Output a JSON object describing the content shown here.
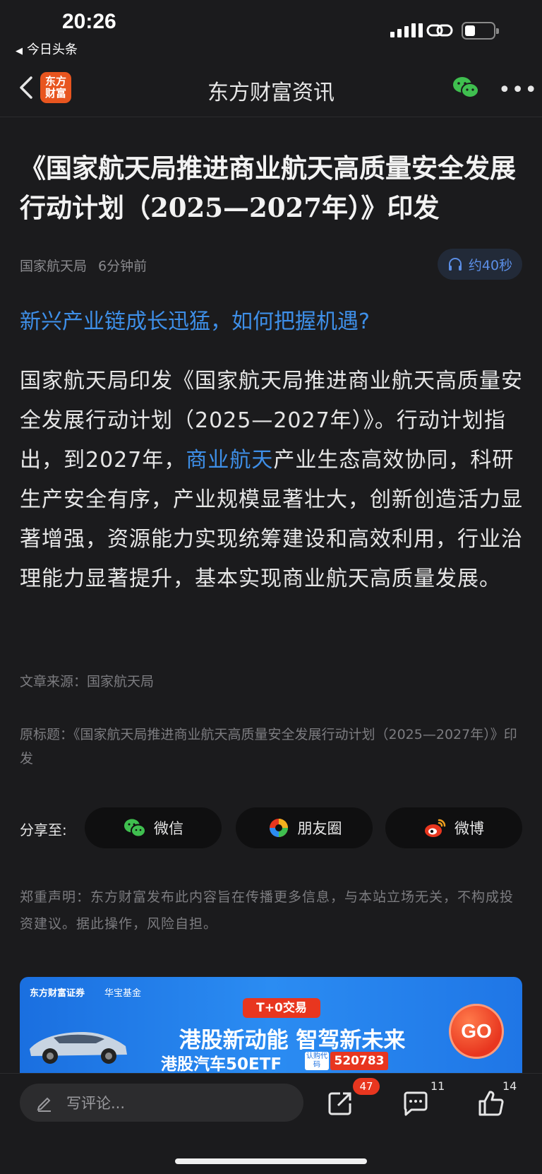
{
  "status_bar": {
    "time": "20:26",
    "back_app": "今日头条"
  },
  "nav": {
    "logo_text": "东方财富",
    "title": "东方财富资讯"
  },
  "article": {
    "headline": "《国家航天局推进商业航天高质量安全发展行动计划（2025—2027年）》印发",
    "author": "国家航天局",
    "time_ago": "6分钟前",
    "audio_label": "约40秒",
    "topic_link": "新兴产业链成长迅猛，如何把握机遇?",
    "body_part1": "国家航天局印发《国家航天局推进商业航天高质量安全发展行动计划（2025—2027年）》。行动计划指出，到2027年，",
    "body_highlight": "商业航天",
    "body_part2": "产业生态高效协同，科研生产安全有序，产业规模显著壮大，创新创造活力显著增强，资源能力实现统筹建设和高效利用，行业治理能力显著提升，基本实现商业航天高质量发展。",
    "source": "文章来源：国家航天局",
    "original_title": "原标题：《国家航天局推进商业航天高质量安全发展行动计划（2025—2027年）》印发"
  },
  "share": {
    "label": "分享至:",
    "buttons": [
      "微信",
      "朋友圈",
      "微博"
    ]
  },
  "disclaimer": "郑重声明：东方财富发布此内容旨在传播更多信息，与本站立场无关，不构成投资建议。据此操作，风险自担。",
  "ad": {
    "brand1": "东方财富证券",
    "brand2": "华宝基金",
    "tag": "T+0交易",
    "headline": "港股新动能 智驾新未来",
    "product": "港股汽车50ETF",
    "code_label": "认购代码",
    "code": "520783",
    "cta": "GO"
  },
  "bottom_bar": {
    "comment_placeholder": "写评论...",
    "share_count": "47",
    "comment_count": "11",
    "like_count": "14"
  },
  "colors": {
    "accent": "#3e8fe8",
    "badge": "#e8361f",
    "background": "#1b1b1d"
  }
}
